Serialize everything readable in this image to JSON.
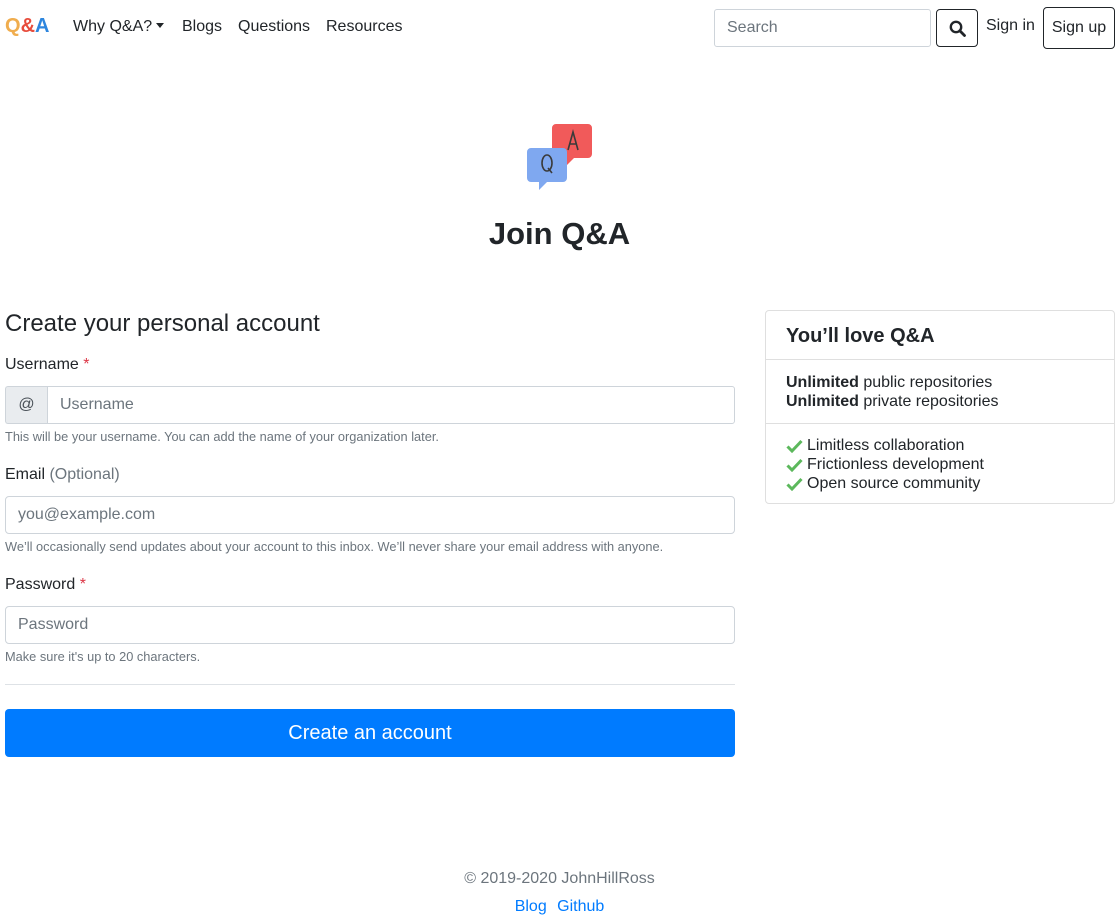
{
  "nav": {
    "brand": {
      "q": "Q",
      "amp": "&",
      "a": "A"
    },
    "items": [
      {
        "label": "Why Q&A?"
      },
      {
        "label": "Blogs"
      },
      {
        "label": "Questions"
      },
      {
        "label": "Resources"
      }
    ],
    "search_placeholder": "Search",
    "signin": "Sign in",
    "signup": "Sign up"
  },
  "hero": {
    "logo_icon": "qa-bubbles-icon",
    "title": "Join Q&A"
  },
  "form": {
    "heading": "Create your personal account",
    "username": {
      "label": "Username",
      "required": "*",
      "addon": "@",
      "placeholder": "Username",
      "value": "",
      "help": "This will be your username. You can add the name of your organization later."
    },
    "email": {
      "label": "Email",
      "optional": "(Optional)",
      "placeholder": "you@example.com",
      "value": "",
      "help": "We’ll occasionally send updates about your account to this inbox. We’ll never share your email address with anyone."
    },
    "password": {
      "label": "Password",
      "required": "*",
      "placeholder": "Password",
      "value": "",
      "help": "Make sure it's up to 20 characters."
    },
    "submit": "Create an account"
  },
  "card": {
    "title": "You’ll love Q&A",
    "plans": [
      {
        "bold": "Unlimited",
        "rest": " public repositories"
      },
      {
        "bold": "Unlimited",
        "rest": " private repositories"
      }
    ],
    "features": [
      "Limitless collaboration",
      "Frictionless development",
      "Open source community"
    ]
  },
  "footer": {
    "copyright": "© 2019-2020 JohnHillRoss",
    "links": [
      "Blog",
      "Github"
    ]
  },
  "colors": {
    "brand_q": "#f0ad4e",
    "brand_amp": "#e74c3c",
    "brand_a": "#2e86de",
    "primary": "#007bff",
    "required": "#dc3545",
    "check": "#5cb85c"
  }
}
